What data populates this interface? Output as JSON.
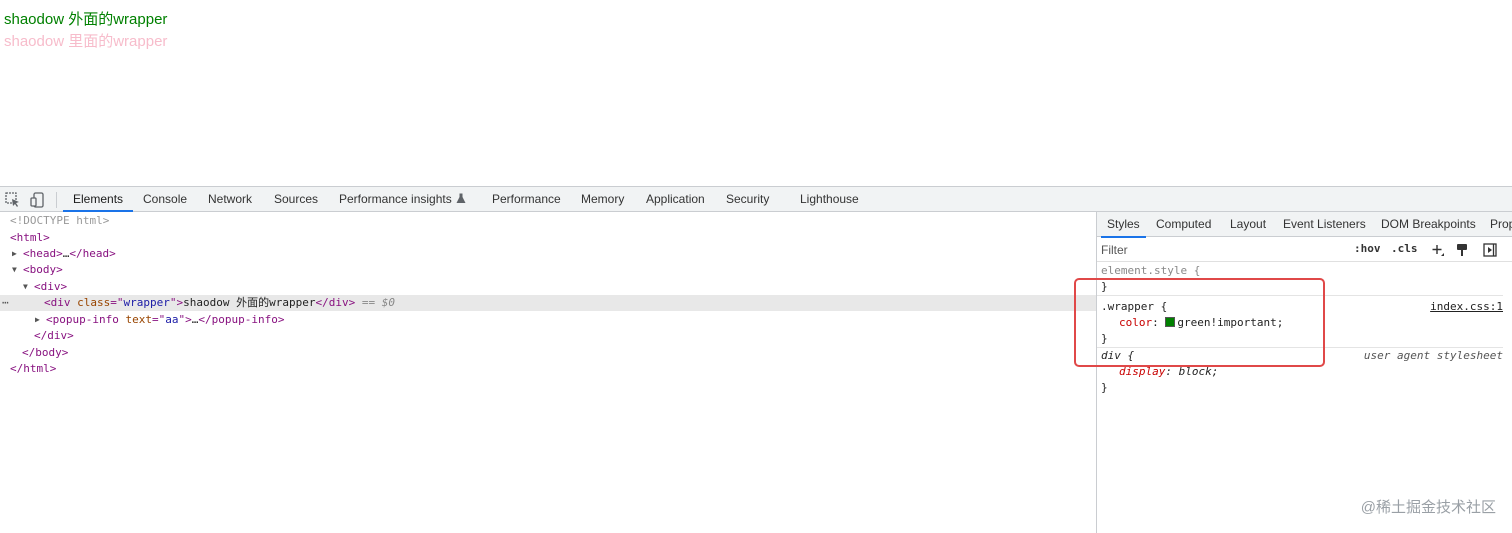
{
  "page": {
    "outer_text": "shaodow 外面的wrapper",
    "outer_color": "#008000",
    "inner_text": "shaodow 里面的wrapper",
    "inner_color": "#f7bccb"
  },
  "devtools": {
    "tabs": [
      {
        "label": "Elements",
        "active": true
      },
      {
        "label": "Console"
      },
      {
        "label": "Network"
      },
      {
        "label": "Sources"
      },
      {
        "label": "Performance insights"
      },
      {
        "label": "Performance"
      },
      {
        "label": "Memory"
      },
      {
        "label": "Application"
      },
      {
        "label": "Security"
      },
      {
        "label": "Lighthouse"
      }
    ],
    "accent": "#1a73e8"
  },
  "elements": {
    "doctype": "<!DOCTYPE html>",
    "html_open": "<html>",
    "head_open": "<head>",
    "head_ellipsis": "…",
    "head_close": "</head>",
    "body_open": "<body>",
    "div_open": "<div>",
    "selected_div_open": "<div",
    "selected_attr_name": "class",
    "selected_attr_eq": "=\"",
    "selected_attr_value": "wrapper",
    "selected_attr_end": "\">",
    "selected_text": "shaodow 外面的wrapper",
    "selected_div_close": "</div>",
    "selected_marker": "== $0",
    "popup_open": "<popup-info",
    "popup_attr_name": "text",
    "popup_attr_eq": "=\"",
    "popup_attr_value": "aa",
    "popup_attr_end": "\">",
    "popup_ellipsis": "…",
    "popup_close": "</popup-info>",
    "div_close": "</div>",
    "body_close": "</body>",
    "html_close": "</html>"
  },
  "sidebar": {
    "tabs": [
      {
        "label": "Styles",
        "active": true
      },
      {
        "label": "Computed"
      },
      {
        "label": "Layout"
      },
      {
        "label": "Event Listeners"
      },
      {
        "label": "DOM Breakpoints"
      },
      {
        "label": "Prop"
      }
    ],
    "filter_placeholder": "Filter",
    "hov_label": ":hov",
    "cls_label": ".cls",
    "rules": {
      "element_selector": "element.style {",
      "element_close": "}",
      "wrapper_selector": ".wrapper {",
      "wrapper_source": "index.css:1",
      "wrapper_prop": "color",
      "wrapper_colon": ": ",
      "wrapper_value": "green!important;",
      "wrapper_close": "}",
      "div_selector": "div {",
      "div_source": "user agent stylesheet",
      "div_prop": "display",
      "div_colon": ": ",
      "div_value": "block;",
      "div_close": "}"
    }
  },
  "watermark": "@稀土掘金技术社区"
}
